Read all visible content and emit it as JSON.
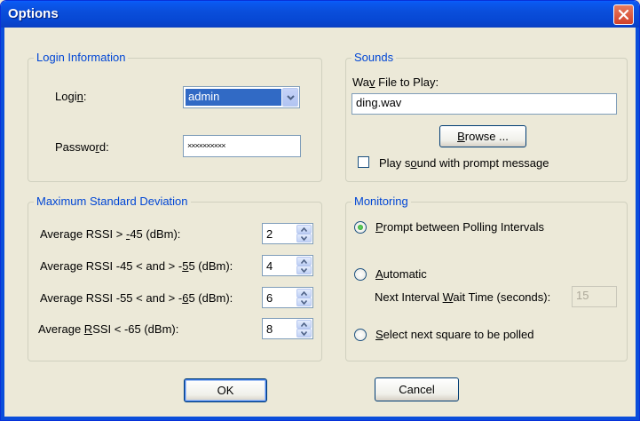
{
  "window": {
    "title": "Options"
  },
  "login_group": {
    "legend": "Login Information",
    "login_label_pre": "Logi",
    "login_label_accel": "n",
    "login_label_post": ":",
    "login_value": "admin",
    "password_label_pre": "Passwo",
    "password_label_accel": "r",
    "password_label_post": "d:",
    "password_value": "××××××××××"
  },
  "sounds_group": {
    "legend": "Sounds",
    "wav_label_pre": "Wa",
    "wav_label_accel": "v",
    "wav_label_post": " File to Play:",
    "wav_value": "ding.wav",
    "browse_pre": "",
    "browse_accel": "B",
    "browse_post": "rowse ...",
    "play_pre": "Play s",
    "play_accel": "o",
    "play_post": "und with prompt message",
    "play_checked": false
  },
  "deviation_group": {
    "legend": "Maximum Standard Deviation",
    "rows": [
      {
        "pre": "Average RSSI > ",
        "accel": "-",
        "post": "45 (dBm):",
        "value": "2"
      },
      {
        "pre": "Average RSSI  -45 < and > -",
        "accel": "5",
        "post": "5 (dBm):",
        "value": "4"
      },
      {
        "pre": "Average RSSI  -55 < and > -",
        "accel": "6",
        "post": "5 (dBm):",
        "value": "6"
      },
      {
        "pre": "Average ",
        "accel": "R",
        "post": "SSI < -65 (dBm):",
        "value": "8"
      }
    ]
  },
  "monitoring_group": {
    "legend": "Monitoring",
    "prompt_accel": "P",
    "prompt_post": "rompt between Polling Intervals",
    "auto_accel": "A",
    "auto_post": "utomatic",
    "wait_pre": "Next Interval ",
    "wait_accel": "W",
    "wait_post": "ait Time (seconds):",
    "wait_value": "15",
    "select_accel": "S",
    "select_post": "elect next square to be polled",
    "selected": "prompt"
  },
  "buttons": {
    "ok": "OK",
    "cancel": "Cancel"
  },
  "colors": {
    "accent": "#0046D5",
    "titlebar": "#0A4EDB",
    "selection": "#316AC5"
  }
}
